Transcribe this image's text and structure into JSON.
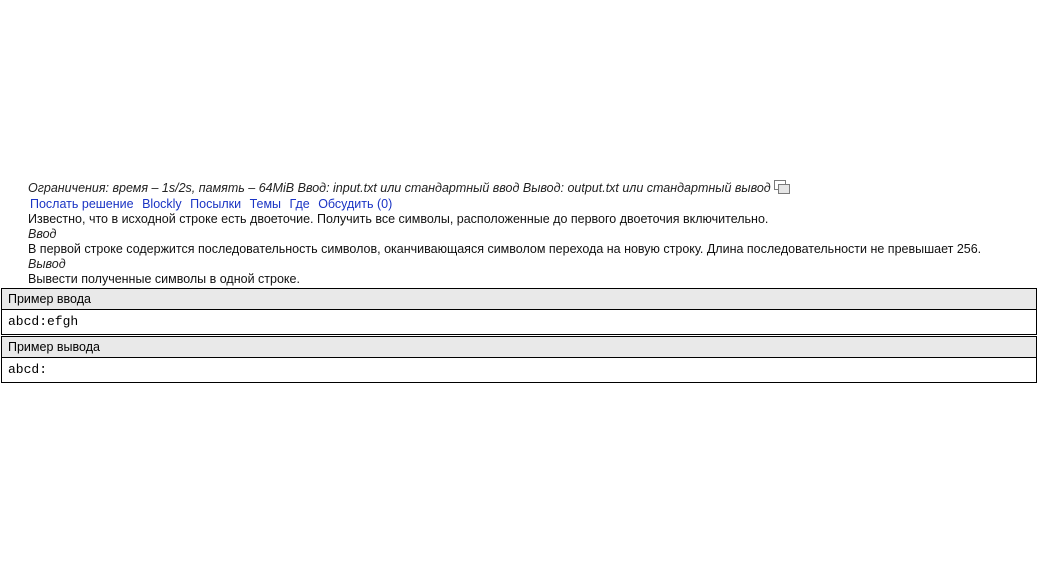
{
  "problem": {
    "limits": "Ограничения: время – 1s/2s, память – 64MiB Ввод: input.txt или стандартный ввод Вывод: output.txt или стандартный вывод",
    "links": [
      {
        "label": "Послать решение"
      },
      {
        "label": "Blockly"
      },
      {
        "label": "Посылки"
      },
      {
        "label": "Темы"
      },
      {
        "label": "Где"
      },
      {
        "label": "Обсудить (0)"
      }
    ],
    "statement": "Известно, что в исходной строке есть двоеточие. Получить все символы, расположенные до первого двоеточия включительно.",
    "input_title": "Ввод",
    "input_text": "В первой строке содержится последовательность символов, оканчивающаяся символом перехода на новую строку. Длина последовательности не превышает 256.",
    "output_title": "Вывод",
    "output_text": "Вывести полученные символы в одной строке."
  },
  "samples": {
    "input_label": "Пример ввода",
    "input_value": "abcd:efgh",
    "output_label": "Пример вывода",
    "output_value": "abcd:"
  },
  "icons": {
    "copy": "copy-icon"
  }
}
